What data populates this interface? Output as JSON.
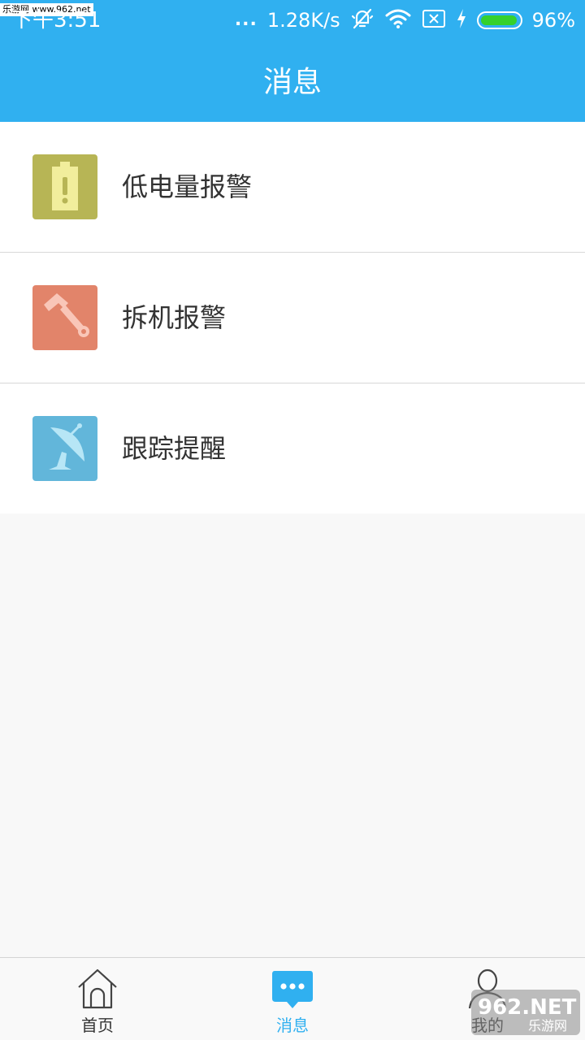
{
  "status_bar": {
    "watermark": "乐游网 www.962.net",
    "time": "下午3:51",
    "dots": "...",
    "network_speed": "1.28K/s",
    "battery_percent": "96%",
    "battery_level": 0.96,
    "icons": [
      "mute-vibrate-icon",
      "wifi-icon",
      "no-sim-icon",
      "charging-icon",
      "battery-icon"
    ]
  },
  "header": {
    "title": "消息"
  },
  "messages": {
    "items": [
      {
        "label": "低电量报警",
        "icon": "low-battery-icon",
        "color": "#b7b555"
      },
      {
        "label": "拆机报警",
        "icon": "hammer-wrench-icon",
        "color": "#e2846a"
      },
      {
        "label": "跟踪提醒",
        "icon": "satellite-dish-icon",
        "color": "#62b6da"
      }
    ]
  },
  "tabbar": {
    "tabs": [
      {
        "label": "首页",
        "icon": "home-icon",
        "active": false
      },
      {
        "label": "消息",
        "icon": "message-bubble-icon",
        "active": true
      },
      {
        "label": "我的",
        "icon": "person-icon",
        "active": false
      }
    ]
  },
  "watermark_logo": {
    "text": "962.NET",
    "subtext": "乐游网"
  },
  "colors": {
    "accent": "#30b0f0",
    "background": "#f8f8f8",
    "battery_green": "#35d12c"
  }
}
